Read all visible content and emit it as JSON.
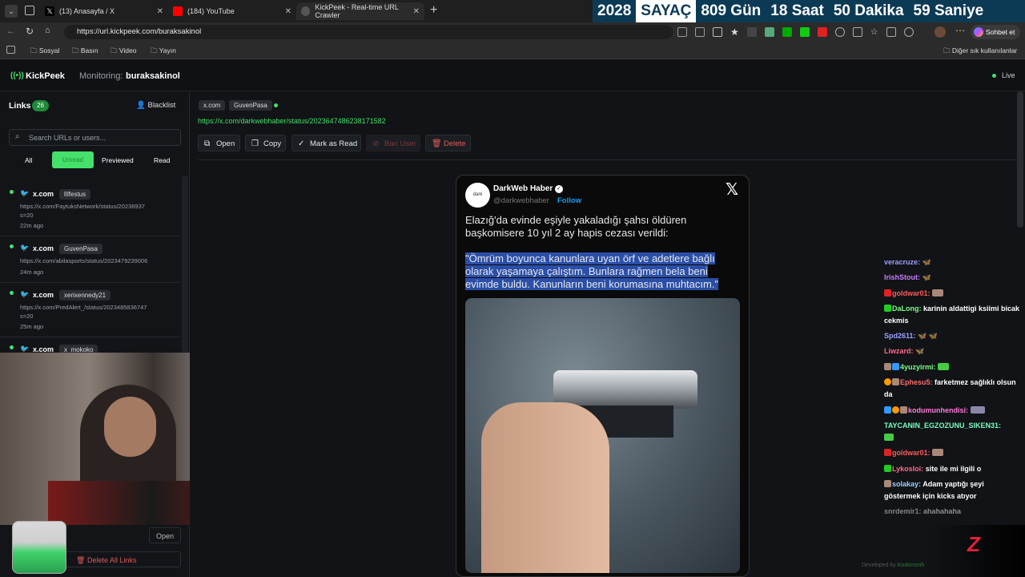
{
  "tabs": [
    {
      "label": "(13) Anasayfa / X"
    },
    {
      "label": "(184) YouTube"
    },
    {
      "label": "KickPeek - Real-time URL Crawler"
    }
  ],
  "counter": {
    "year": "2028",
    "title": "SAYAÇ",
    "days": "809 Gün",
    "hours": "18 Saat",
    "minutes": "50 Dakika",
    "seconds": "59 Saniye"
  },
  "address": {
    "url": "https://url.kickpeek.com/buraksakinol",
    "chat_label": "Sohbet et"
  },
  "bookmarks": [
    "Sosyal",
    "Basın",
    "Video",
    "Yayın"
  ],
  "bookmarks_right": "Diğer sık kullanılanlar",
  "app": {
    "logo": "KickPeek",
    "monitoring_label": "Monitoring:",
    "monitoring_user": "buraksakinol",
    "live": "Live"
  },
  "sidebar": {
    "links_label": "Links",
    "links_count": "26",
    "blacklist": "Blacklist",
    "search_placeholder": "Search URLs or users...",
    "filters": [
      "All",
      "Unread",
      "Previewed",
      "Read"
    ],
    "items": [
      {
        "site": "x.com",
        "user": "lIlfestus",
        "url": "https://x.com/FaytuksNetwork/status/20236937",
        "url2": "s=20",
        "time": "22m ago"
      },
      {
        "site": "x.com",
        "user": "GuvenPasa",
        "url": "https://x.com/abilasports/status/2023479239006",
        "url2": "",
        "time": "24m ago"
      },
      {
        "site": "x.com",
        "user": "xerixennedy21",
        "url": "https://x.com/PredAlert_/status/2023485836747",
        "url2": "s=20",
        "time": "25m ago"
      },
      {
        "site": "x.com",
        "user": "x_mokoko",
        "url": "",
        "url2": "",
        "time": ""
      }
    ],
    "open": "Open",
    "delete_all": "Delete All Links"
  },
  "detail": {
    "site": "x.com",
    "user": "GuvenPasa",
    "url": "https://x.com/darkwebhaber/status/2023647486238171582",
    "actions": {
      "open": "Open",
      "copy": "Copy",
      "mark": "Mark as Read",
      "ban": "Ban User",
      "delete": "Delete"
    }
  },
  "tweet": {
    "name": "DarkWeb Haber",
    "handle": "@darkwebhaber",
    "follow": "Follow",
    "avatar": "dark",
    "line1": "Elazığ'da evinde eşiyle yakaladığı şahsı öldüren",
    "line2": "başkomisere 10 yıl 2 ay hapis cezası verildi:",
    "q1": "\"Ömrüm boyunca kanunlara uyan örf ve adetlere bağlı",
    "q2": "olarak yaşamaya çalıştım. Bunlara rağmen bela beni",
    "q3": "evimde buldu. Kanunların beni korumasına muhtacım.\""
  },
  "chat": [
    {
      "user": "veracruze:",
      "msg": "",
      "color": "#9aa0ff"
    },
    {
      "user": "IrishStout:",
      "msg": "",
      "color": "#c77dff"
    },
    {
      "user": "goldwar01:",
      "msg": "",
      "color": "#ff5a5a"
    },
    {
      "user": "DaLong:",
      "msg": "karinin aldattigi ksiimi bicak cekmis",
      "color": "#7cfc8a"
    },
    {
      "user": "Spd2611:",
      "msg": "",
      "color": "#9aa0ff"
    },
    {
      "user": "Liwzard:",
      "msg": "",
      "color": "#ff6a8a"
    },
    {
      "user": "4yuzyirmi:",
      "msg": "",
      "color": "#7cfc8a"
    },
    {
      "user": "Ephesu5:",
      "msg": "farketmez sağlıklı olsun da",
      "color": "#ff6a6a"
    },
    {
      "user": "kodumunhendisi:",
      "msg": "",
      "color": "#ff7ad9"
    },
    {
      "user": "TAYCANIN_EGZOZUNU_SIKEN31:",
      "msg": "",
      "color": "#7cfcc0"
    },
    {
      "user": "goldwar01:",
      "msg": "",
      "color": "#ff5a5a"
    },
    {
      "user": "Lykosloi:",
      "msg": "site ile mi ilgili o",
      "color": "#ff6a8a"
    },
    {
      "user": "solakay:",
      "msg": "Adam yaptığı şeyi göstermek için kicks atıyor",
      "color": "#9ad0ff"
    },
    {
      "user": "snrdemir1:",
      "msg": "ahahahaha",
      "color": "#cccccc"
    }
  ],
  "footer": {
    "dev": "Developed by",
    "dev_name": "Kodomsrih"
  }
}
